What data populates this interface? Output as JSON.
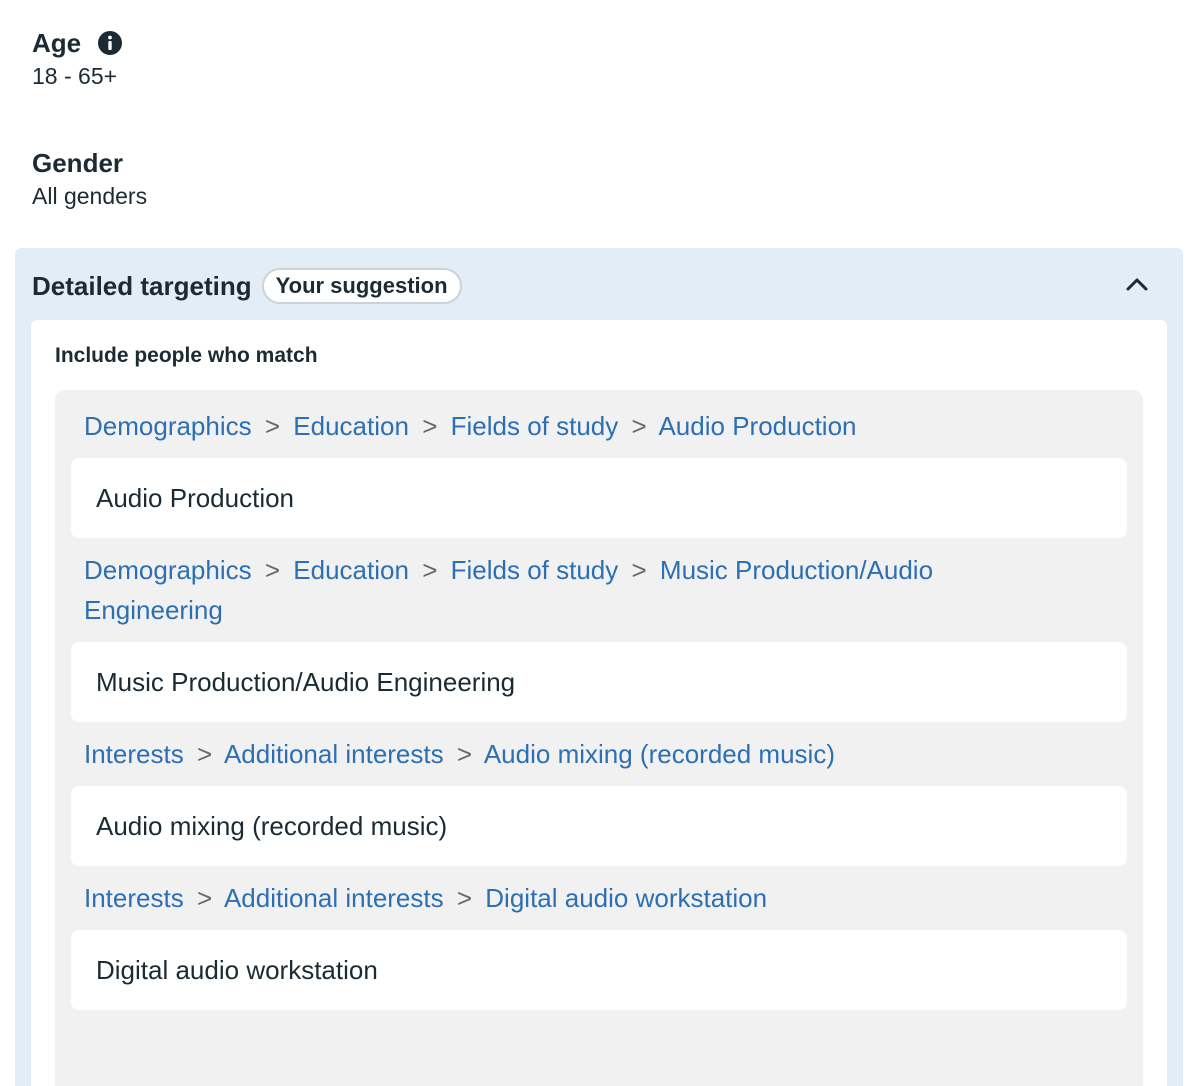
{
  "age": {
    "label": "Age",
    "value": "18 - 65+"
  },
  "gender": {
    "label": "Gender",
    "value": "All genders"
  },
  "detailed_targeting": {
    "title": "Detailed targeting",
    "badge": "Your suggestion",
    "include_label": "Include people who match",
    "separator": ">",
    "entries": [
      {
        "path": [
          "Demographics",
          "Education",
          "Fields of study",
          "Audio Production"
        ],
        "item": "Audio Production"
      },
      {
        "path": [
          "Demographics",
          "Education",
          "Fields of study",
          "Music Production/Audio Engineering"
        ],
        "item": "Music Production/Audio Engineering"
      },
      {
        "path": [
          "Interests",
          "Additional interests",
          "Audio mixing (recorded music)"
        ],
        "item": "Audio mixing (recorded music)"
      },
      {
        "path": [
          "Interests",
          "Additional interests",
          "Digital audio workstation"
        ],
        "item": "Digital audio workstation"
      }
    ]
  },
  "colors": {
    "link": "#2d6fb3",
    "panel": "#e3edf6",
    "match_box": "#f1f1f1",
    "text": "#1c2b33"
  }
}
